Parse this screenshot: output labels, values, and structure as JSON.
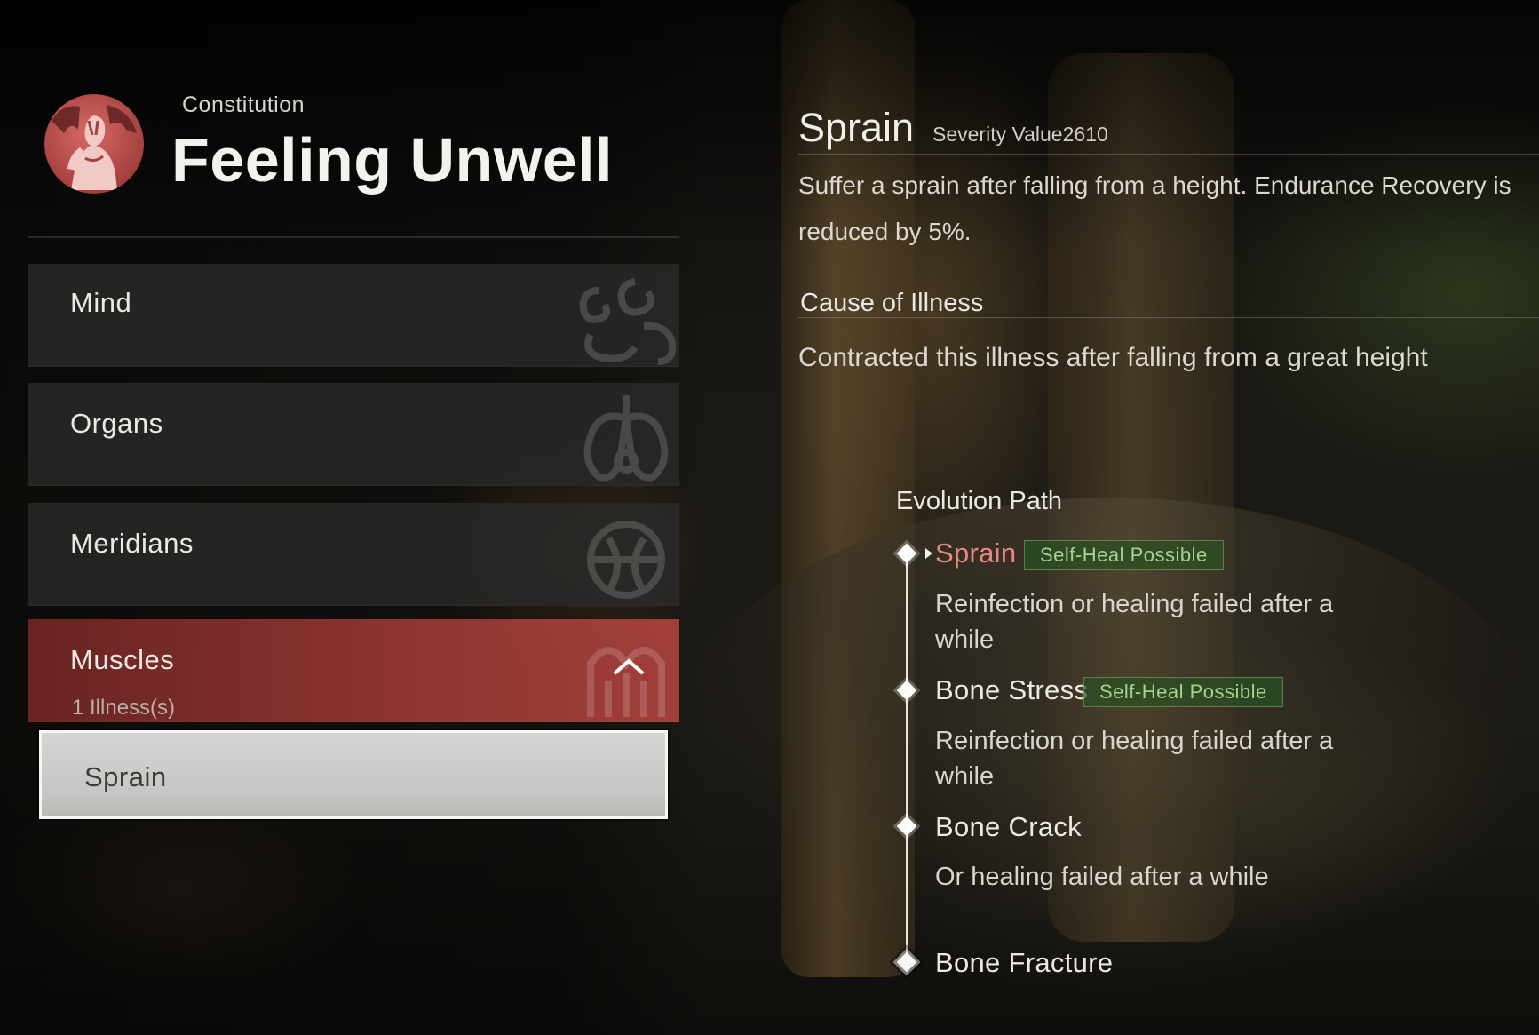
{
  "header": {
    "subtitle": "Constitution",
    "title": "Feeling Unwell"
  },
  "categories": [
    {
      "label": "Mind",
      "icon": "swirl-emblem-icon"
    },
    {
      "label": "Organs",
      "icon": "organ-emblem-icon"
    },
    {
      "label": "Meridians",
      "icon": "meridian-emblem-icon"
    },
    {
      "label": "Muscles",
      "sub": "1 Illness(s)",
      "icon": "muscle-emblem-icon",
      "expanded": true
    }
  ],
  "illnesses": [
    {
      "label": "Sprain",
      "selected": true
    }
  ],
  "detail": {
    "name": "Sprain",
    "severity": "Severity Value2610",
    "description_line1": "Suffer a sprain after falling from a height. Endurance Recovery is",
    "description_line2": "reduced by 5%.",
    "cause_heading": "Cause of Illness",
    "cause_text": "Contracted this illness after falling from a great height",
    "evolution_heading": "Evolution Path",
    "stages": [
      {
        "name": "Sprain",
        "badge": "Self-Heal Possible",
        "condition": "Reinfection or healing failed after a while",
        "current": true
      },
      {
        "name": "Bone Stress",
        "badge": "Self-Heal Possible",
        "condition": "Reinfection or healing failed after a while"
      },
      {
        "name": "Bone Crack",
        "condition": "Or healing failed after a while"
      },
      {
        "name": "Bone Fracture"
      }
    ]
  },
  "colors": {
    "accent_red": "#e88683",
    "active_category": "#b5453f",
    "badge_text": "#a8d08f",
    "badge_bg": "#2d5025"
  }
}
